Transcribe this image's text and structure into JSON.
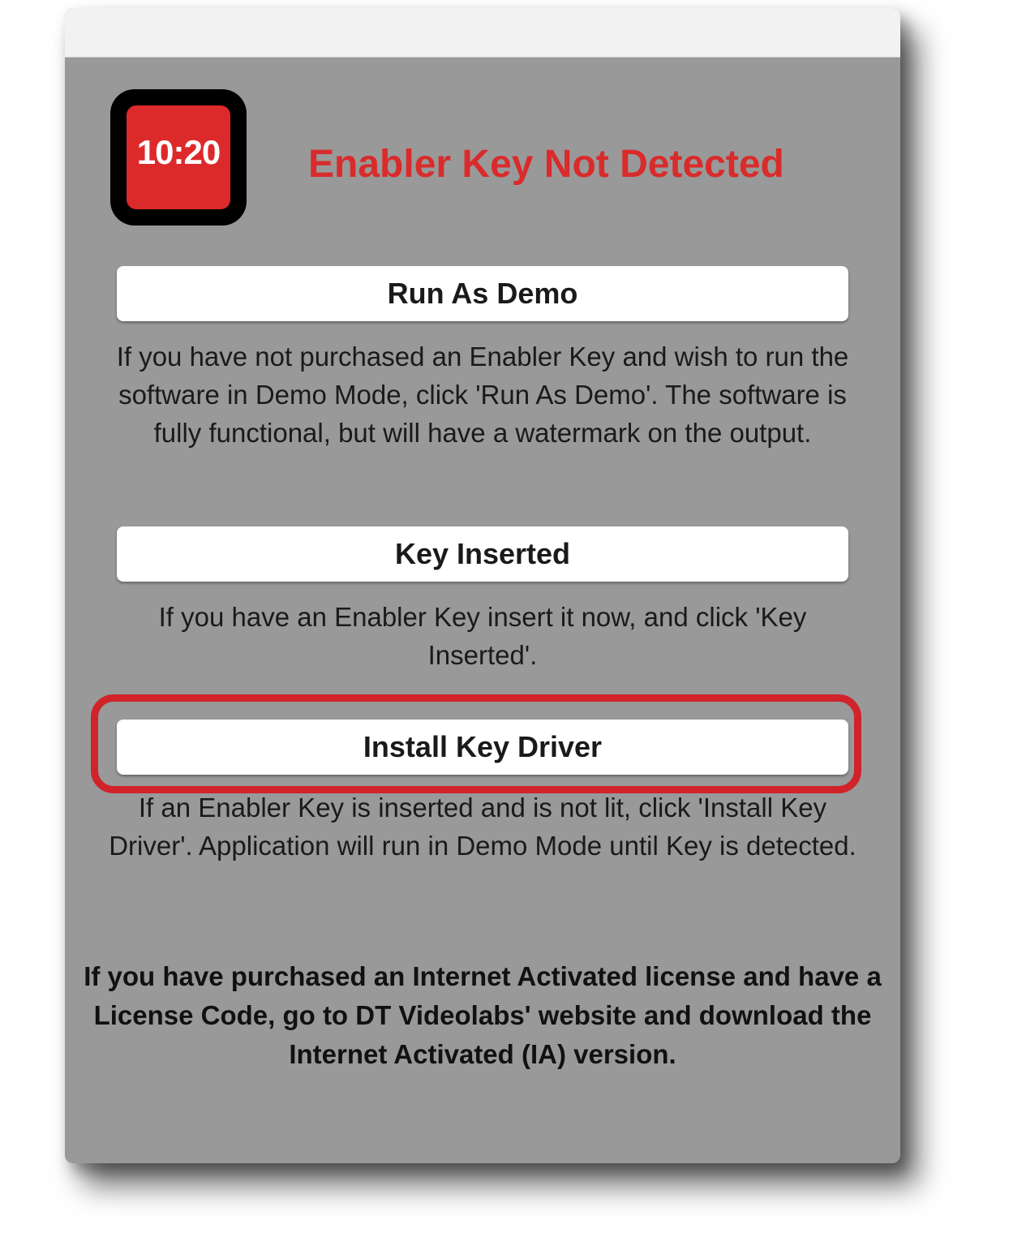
{
  "app_icon": {
    "time": "10:20"
  },
  "dialog": {
    "title": "Enabler Key Not Detected",
    "run_demo": {
      "label": "Run As Demo",
      "description": "If you have not purchased an Enabler Key and wish to run the software in Demo Mode, click 'Run As Demo'. The software is fully functional, but will have a watermark on the output."
    },
    "key_inserted": {
      "label": "Key Inserted",
      "description": "If you have an Enabler Key insert it now, and click 'Key Inserted'."
    },
    "install_driver": {
      "label": "Install Key Driver",
      "description": "If an Enabler Key is inserted and is not lit, click 'Install Key Driver'.  Application will run in Demo Mode until Key is detected."
    },
    "footer": "If you have purchased an Internet Activated license and have a License Code, go to DT Videolabs' website and download the Internet Activated (IA) version."
  },
  "colors": {
    "window_bg": "#999999",
    "title_red": "#d92b2b",
    "highlight_red": "#d0232a",
    "icon_red": "#dc2a2a"
  }
}
